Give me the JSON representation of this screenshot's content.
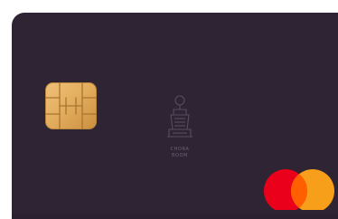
{
  "card": {
    "background_color": "#2e2433",
    "chip_color": "#e2ac5c",
    "emblem": {
      "icon": "house-crest-icon",
      "line1": "CHORA",
      "line2": "BOOM"
    },
    "network_logo": {
      "icon": "mastercard-logo-icon",
      "red": "#eb001b",
      "orange": "#f79e1b",
      "overlap": "#ff5f00"
    }
  }
}
